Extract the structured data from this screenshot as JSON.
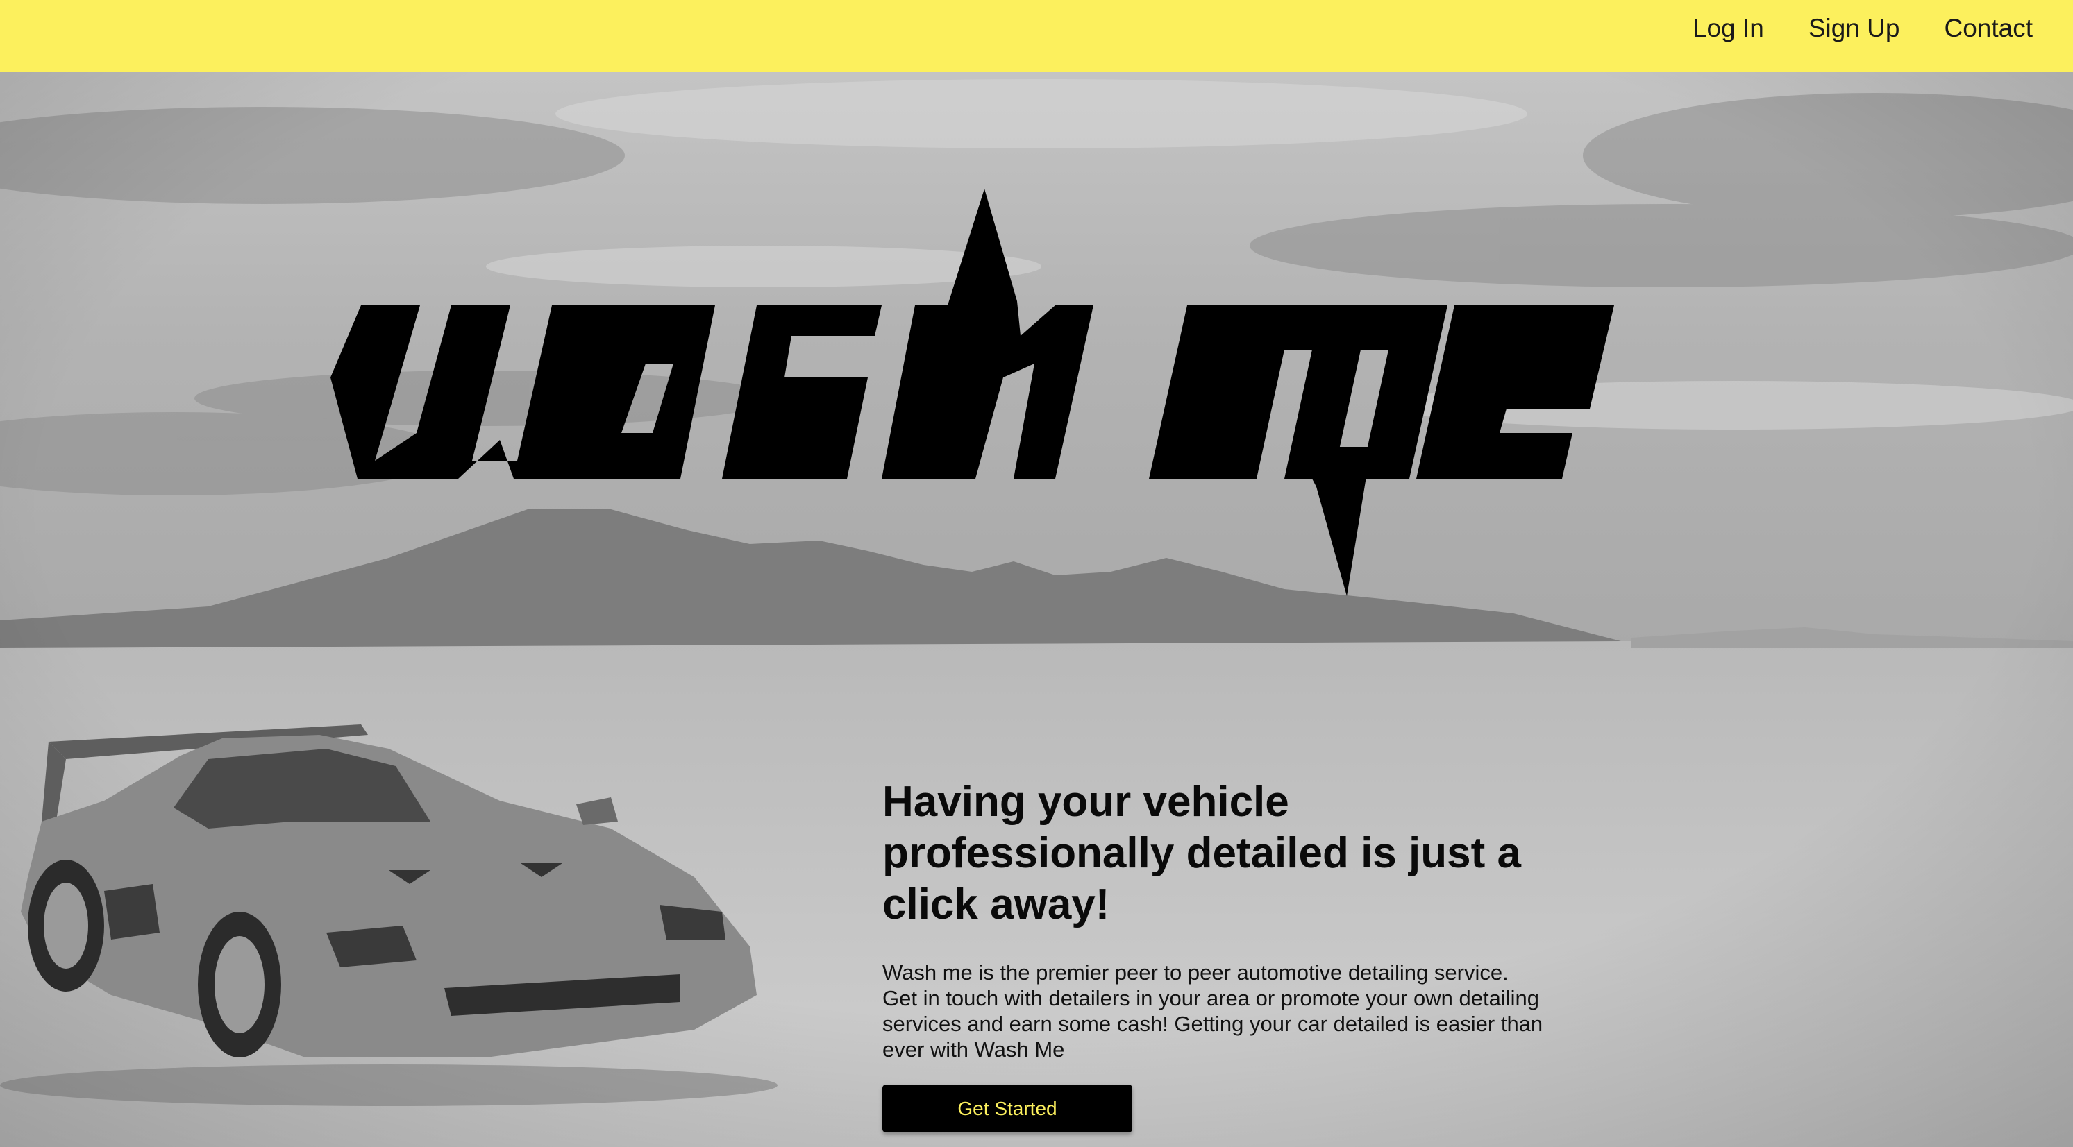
{
  "nav": {
    "items": [
      {
        "label": "Log In"
      },
      {
        "label": "Sign Up"
      },
      {
        "label": "Contact"
      }
    ]
  },
  "brand": {
    "logo_text": "wash me"
  },
  "hero": {
    "headline": "Having your vehicle professionally detailed is just a click away!",
    "description": "Wash me is the premier peer to peer automotive detailing service. Get in touch with detailers in your area or promote your own detailing services and earn some cash! Getting your car detailed is easier than ever with Wash Me",
    "cta_label": "Get Started"
  },
  "colors": {
    "accent": "#fcf05d",
    "text": "#000000",
    "background": "#bdbdbd"
  }
}
